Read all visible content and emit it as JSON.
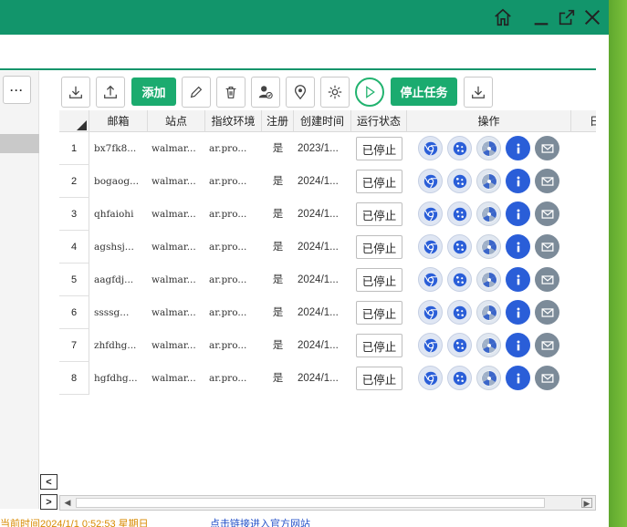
{
  "window": {
    "buttons": [
      "home",
      "minimize",
      "popout",
      "close"
    ]
  },
  "left_panel": {
    "more_label": "···"
  },
  "toolbar": {
    "add_label": "添加",
    "stop_task_label": "停止任务"
  },
  "table": {
    "columns": [
      "邮箱",
      "站点",
      "指纹环境",
      "注册",
      "创建时间",
      "运行状态",
      "操作",
      "日"
    ],
    "rows": [
      {
        "num": "1",
        "email": "bx7fk8...",
        "site": "walmar...",
        "env": "ar.pro...",
        "reg": "是",
        "created": "2023/1...",
        "status": "已停止"
      },
      {
        "num": "2",
        "email": "bogaog...",
        "site": "walmar...",
        "env": "ar.pro...",
        "reg": "是",
        "created": "2024/1...",
        "status": "已停止"
      },
      {
        "num": "3",
        "email": "qhfaiohi",
        "site": "walmar...",
        "env": "ar.pro...",
        "reg": "是",
        "created": "2024/1...",
        "status": "已停止"
      },
      {
        "num": "4",
        "email": "agshsj...",
        "site": "walmar...",
        "env": "ar.pro...",
        "reg": "是",
        "created": "2024/1...",
        "status": "已停止"
      },
      {
        "num": "5",
        "email": "aagfdj...",
        "site": "walmar...",
        "env": "ar.pro...",
        "reg": "是",
        "created": "2024/1...",
        "status": "已停止"
      },
      {
        "num": "6",
        "email": "ssssg...",
        "site": "walmar...",
        "env": "ar.pro...",
        "reg": "是",
        "created": "2024/1...",
        "status": "已停止"
      },
      {
        "num": "7",
        "email": "zhfdhg...",
        "site": "walmar...",
        "env": "ar.pro...",
        "reg": "是",
        "created": "2024/1...",
        "status": "已停止"
      },
      {
        "num": "8",
        "email": "hgfdhg...",
        "site": "walmar...",
        "env": "ar.pro...",
        "reg": "是",
        "created": "2024/1...",
        "status": "已停止"
      }
    ],
    "row_ops": [
      "chrome-icon",
      "cookie-icon",
      "radiation-icon",
      "info-icon",
      "mail-icon"
    ]
  },
  "nav": {
    "prev": "<",
    "next": ">"
  },
  "statusbar": {
    "text": "当前时间2024/1/1 0:52:53 星期日",
    "link": "点击链接进入官方网站"
  },
  "colors": {
    "title_green": "#12956b",
    "button_green": "#1bab6f",
    "info_blue": "#2a5ed8",
    "mail_gray": "#7c8b99"
  }
}
